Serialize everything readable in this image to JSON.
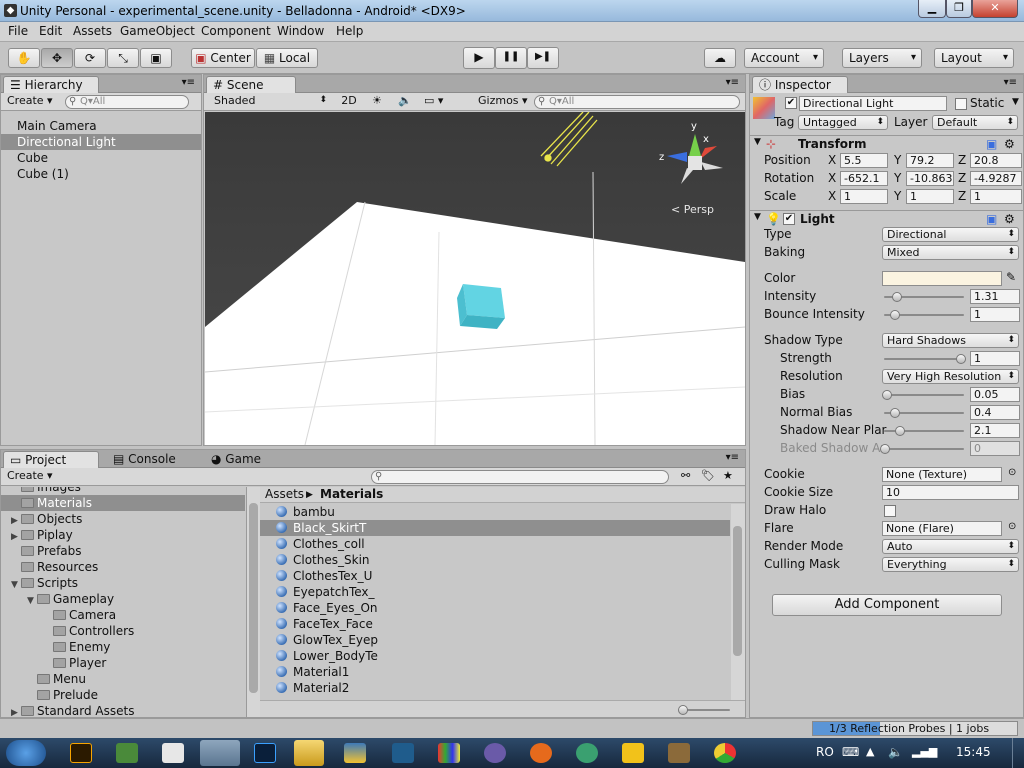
{
  "window": {
    "title": "Unity Personal - experimental_scene.unity - Belladonna - Android* <DX9>",
    "controls": [
      "▁",
      "❐",
      "✕"
    ]
  },
  "menu": [
    "File",
    "Edit",
    "Assets",
    "GameObject",
    "Component",
    "Window",
    "Help"
  ],
  "toolbar": {
    "pivot": "Center",
    "space": "Local",
    "account": "Account",
    "layers": "Layers",
    "layout": "Layout",
    "play": "▶",
    "pause": "❚❚",
    "step": "▶❚"
  },
  "hierarchy": {
    "tab": "Hierarchy",
    "create": "Create",
    "search": "Q▾All",
    "items": [
      "Main Camera",
      "Directional Light",
      "Cube",
      "Cube (1)"
    ],
    "selected": 1
  },
  "scene": {
    "tab": "Scene",
    "shading": "Shaded",
    "mode2d": "2D",
    "gizmos": "Gizmos",
    "search": "Q▾All",
    "persp": "< Persp",
    "axis_x": "x",
    "axis_y": "y",
    "axis_z": "z"
  },
  "project": {
    "tabs": [
      "Project",
      "Console",
      "Game"
    ],
    "create": "Create",
    "tree": [
      {
        "label": "Images",
        "depth": 1,
        "arrow": ""
      },
      {
        "label": "Materials",
        "depth": 1,
        "arrow": "",
        "sel": true
      },
      {
        "label": "Objects",
        "depth": 1,
        "arrow": "▶"
      },
      {
        "label": "Piplay",
        "depth": 1,
        "arrow": "▶"
      },
      {
        "label": "Prefabs",
        "depth": 1,
        "arrow": ""
      },
      {
        "label": "Resources",
        "depth": 1,
        "arrow": ""
      },
      {
        "label": "Scripts",
        "depth": 1,
        "arrow": "▼"
      },
      {
        "label": "Gameplay",
        "depth": 2,
        "arrow": "▼"
      },
      {
        "label": "Camera",
        "depth": 3,
        "arrow": ""
      },
      {
        "label": "Controllers",
        "depth": 3,
        "arrow": ""
      },
      {
        "label": "Enemy",
        "depth": 3,
        "arrow": ""
      },
      {
        "label": "Player",
        "depth": 3,
        "arrow": ""
      },
      {
        "label": "Menu",
        "depth": 2,
        "arrow": ""
      },
      {
        "label": "Prelude",
        "depth": 2,
        "arrow": ""
      },
      {
        "label": "Standard Assets",
        "depth": 1,
        "arrow": "▶"
      }
    ],
    "breadcrumb": [
      "Assets",
      "Materials"
    ],
    "assets": [
      "bambu",
      "Black_SkirtT",
      "Clothes_coll",
      "Clothes_Skin",
      "ClothesTex_U",
      "EyepatchTex_",
      "Face_Eyes_On",
      "FaceTex_Face",
      "GlowTex_Eyep",
      "Lower_BodyTe",
      "Material1",
      "Material2"
    ],
    "asset_selected": 1
  },
  "inspector": {
    "tab": "Inspector",
    "object_name": "Directional Light",
    "static": "Static",
    "tag_label": "Tag",
    "tag": "Untagged",
    "layer_label": "Layer",
    "layer": "Default",
    "transform": {
      "title": "Transform",
      "rows": [
        {
          "label": "Position",
          "x": "5.5",
          "y": "79.2",
          "z": "20.8"
        },
        {
          "label": "Rotation",
          "x": "-652.1",
          "y": "-10.863",
          "z": "-4.9287"
        },
        {
          "label": "Scale",
          "x": "1",
          "y": "1",
          "z": "1"
        }
      ],
      "X": "X",
      "Y": "Y",
      "Z": "Z"
    },
    "light": {
      "title": "Light",
      "type_label": "Type",
      "type": "Directional",
      "baking_label": "Baking",
      "baking": "Mixed",
      "color_label": "Color",
      "color": "#fbf4e1",
      "intensity_label": "Intensity",
      "intensity": "1.31",
      "intensity_frac": 0.16,
      "bounce_label": "Bounce Intensity",
      "bounce": "1",
      "bounce_frac": 0.125,
      "shadow_type_label": "Shadow Type",
      "shadow_type": "Hard Shadows",
      "strength_label": "Strength",
      "strength": "1",
      "strength_frac": 1.0,
      "resolution_label": "Resolution",
      "resolution": "Very High Resolution",
      "bias_label": "Bias",
      "bias": "0.05",
      "bias_frac": 0.025,
      "normal_bias_label": "Normal Bias",
      "normal_bias": "0.4",
      "normal_bias_frac": 0.13,
      "near_label": "Shadow Near Plar",
      "near": "2.1",
      "near_frac": 0.2,
      "baked_label": "Baked Shadow Ar",
      "baked": "0",
      "baked_frac": 0,
      "cookie_label": "Cookie",
      "cookie": "None (Texture)",
      "cookie_size_label": "Cookie Size",
      "cookie_size": "10",
      "halo_label": "Draw Halo",
      "flare_label": "Flare",
      "flare": "None (Flare)",
      "render_label": "Render Mode",
      "render": "Auto",
      "culling_label": "Culling Mask",
      "culling": "Everything"
    },
    "add_component": "Add Component"
  },
  "status": {
    "progress": "1/3 Reflection Probes | 1 jobs",
    "progress_frac": 0.33
  },
  "taskbar": {
    "lang": "RO",
    "time": "15:45"
  }
}
